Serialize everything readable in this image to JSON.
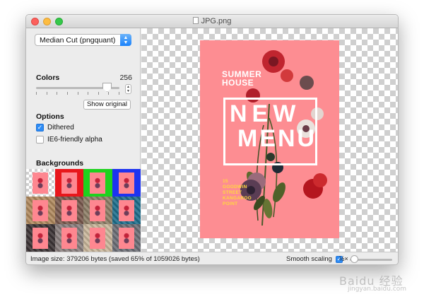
{
  "window": {
    "title": "JPG.png"
  },
  "sidebar": {
    "algorithm_select": "Median Cut (pngquant)",
    "colors_label": "Colors",
    "colors_value": "256",
    "show_original_button": "Show original",
    "options_label": "Options",
    "options": [
      {
        "label": "Dithered",
        "checked": true
      },
      {
        "label": "IE6-friendly alpha",
        "checked": false
      }
    ],
    "backgrounds_label": "Backgrounds",
    "backgrounds": [
      {
        "bg": "#cfcfcf",
        "pattern": "checker",
        "selected": false
      },
      {
        "bg": "#e8171c",
        "pattern": "solid",
        "selected": false
      },
      {
        "bg": "#1ed21e",
        "pattern": "solid",
        "selected": false
      },
      {
        "bg": "#1d33f0",
        "pattern": "solid",
        "selected": false
      },
      {
        "bg": "#b08a5e",
        "pattern": "texture",
        "selected": false
      },
      {
        "bg": "#7a5a4e",
        "pattern": "texture",
        "selected": false
      },
      {
        "bg": "#8e8068",
        "pattern": "texture",
        "selected": false
      },
      {
        "bg": "#1f6f8d",
        "pattern": "texture",
        "selected": false
      },
      {
        "bg": "#3c3436",
        "pattern": "texture",
        "selected": false
      },
      {
        "bg": "#8a7f7e",
        "pattern": "texture",
        "selected": false
      },
      {
        "bg": "#c9b79c",
        "pattern": "texture",
        "selected": false
      },
      {
        "bg": "#6c6e76",
        "pattern": "texture",
        "selected": false
      }
    ]
  },
  "poster": {
    "line1": "SUMMER",
    "line2": "HOUSE",
    "headline1": "NEW",
    "headline2": "MENU",
    "address": [
      "15",
      "GOODWIN",
      "STREET",
      "KANGAROO",
      "POINT"
    ],
    "background_color": "#fd8d92"
  },
  "statusbar": {
    "image_size_text": "Image size: 379206 bytes (saved 65% of 1059026 bytes)",
    "smooth_scaling_label": "Smooth scaling",
    "smooth_scaling_checked": true,
    "zoom_label": "½×"
  },
  "watermark": {
    "text": "Baidu 经验",
    "sub": "jingyan.baidu.com"
  }
}
